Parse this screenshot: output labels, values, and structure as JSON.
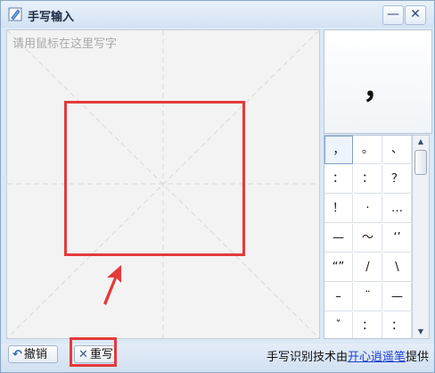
{
  "window": {
    "title": "手写输入"
  },
  "titlebar": {
    "min_glyph": "—",
    "close_glyph": "✕"
  },
  "canvas": {
    "hint": "请用鼠标在这里写字"
  },
  "preview": {
    "char": "，"
  },
  "candidates": [
    "，",
    "。",
    "、",
    "：",
    "：",
    "？",
    "！",
    "·",
    "…",
    "—",
    "～",
    "‘’",
    "“”",
    "/",
    "\\",
    "–",
    "¨",
    "—",
    "ˇ",
    "：",
    "："
  ],
  "bottom": {
    "undo_label": "撤销",
    "rewrite_label": "重写",
    "credit_prefix": "手写识别技术由",
    "credit_link": "开心逍遥笔",
    "credit_suffix": "提供"
  },
  "icons": {
    "app": "pencil-icon",
    "undo": "undo-arrow-icon",
    "rewrite": "x-icon"
  },
  "colors": {
    "highlight": "#e53a3a",
    "link": "#1f3fd1"
  }
}
